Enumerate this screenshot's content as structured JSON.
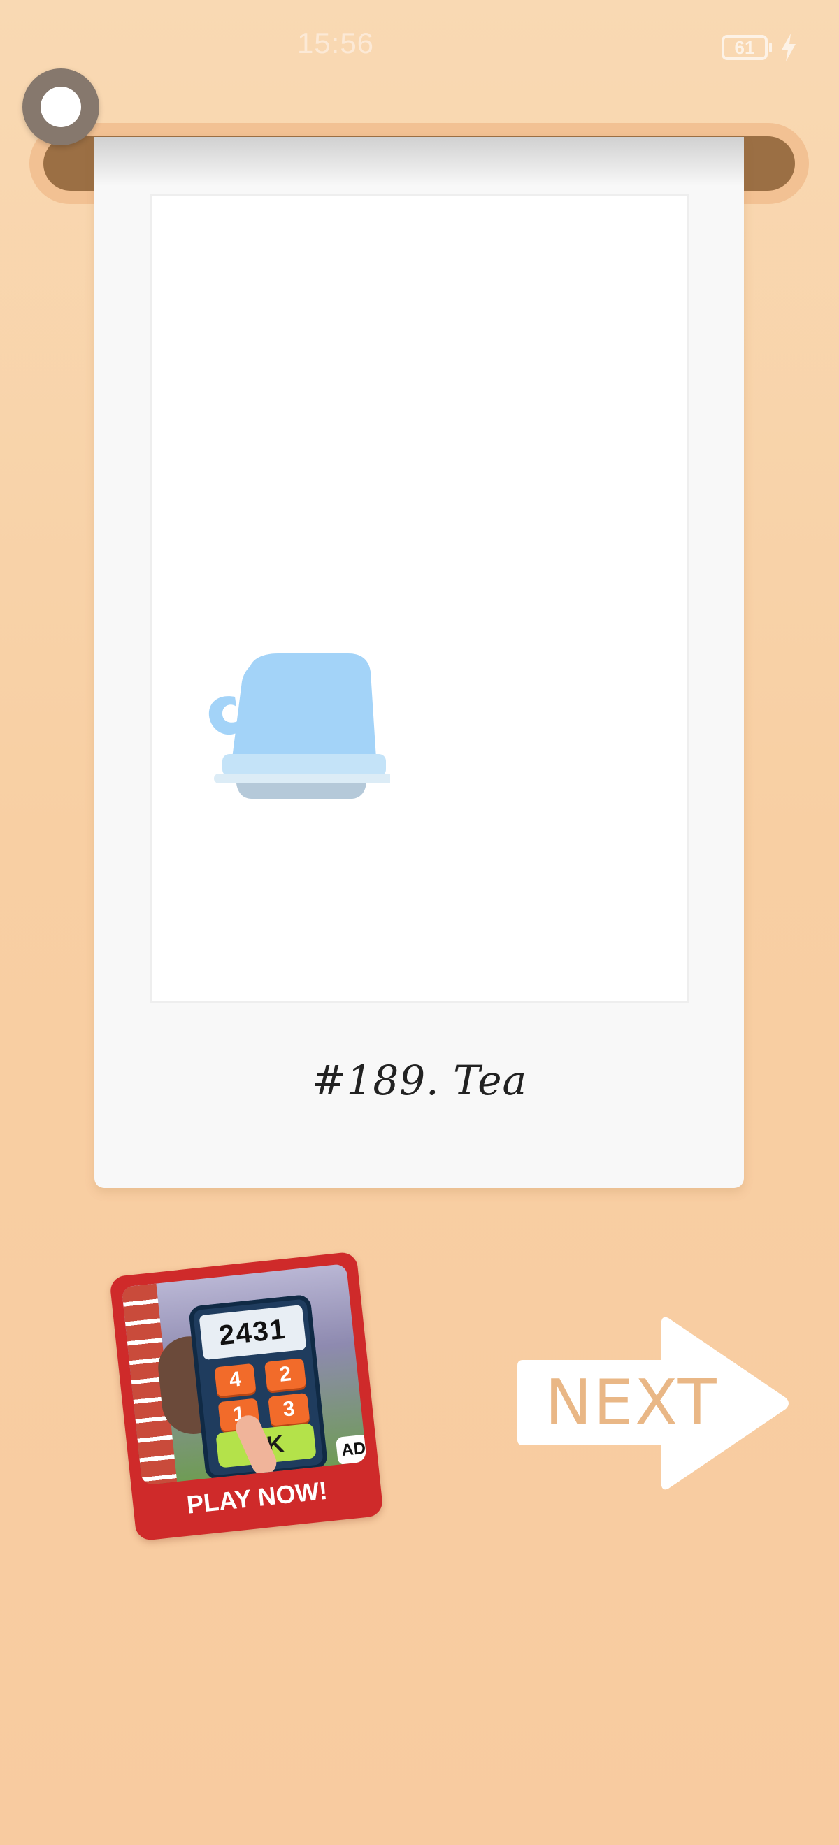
{
  "status_bar": {
    "time": "15:56",
    "battery_level": "61",
    "charging_icon": "bolt-icon"
  },
  "card": {
    "caption": "#189. Tea",
    "drawing_icon": "teacup-icon",
    "drawing_color": "#a3d3f8"
  },
  "ad": {
    "screen_number": "2431",
    "keys": [
      "4",
      "2",
      "1",
      "3"
    ],
    "ok_label": "OK",
    "badge": "AD",
    "cta": "PLAY NOW!"
  },
  "navigation": {
    "next_label": "NEXT"
  },
  "colors": {
    "background": "#f8cfa3",
    "rod": "#9b6f44",
    "next_text": "#e9b786",
    "ad_red": "#cf2a2a"
  }
}
